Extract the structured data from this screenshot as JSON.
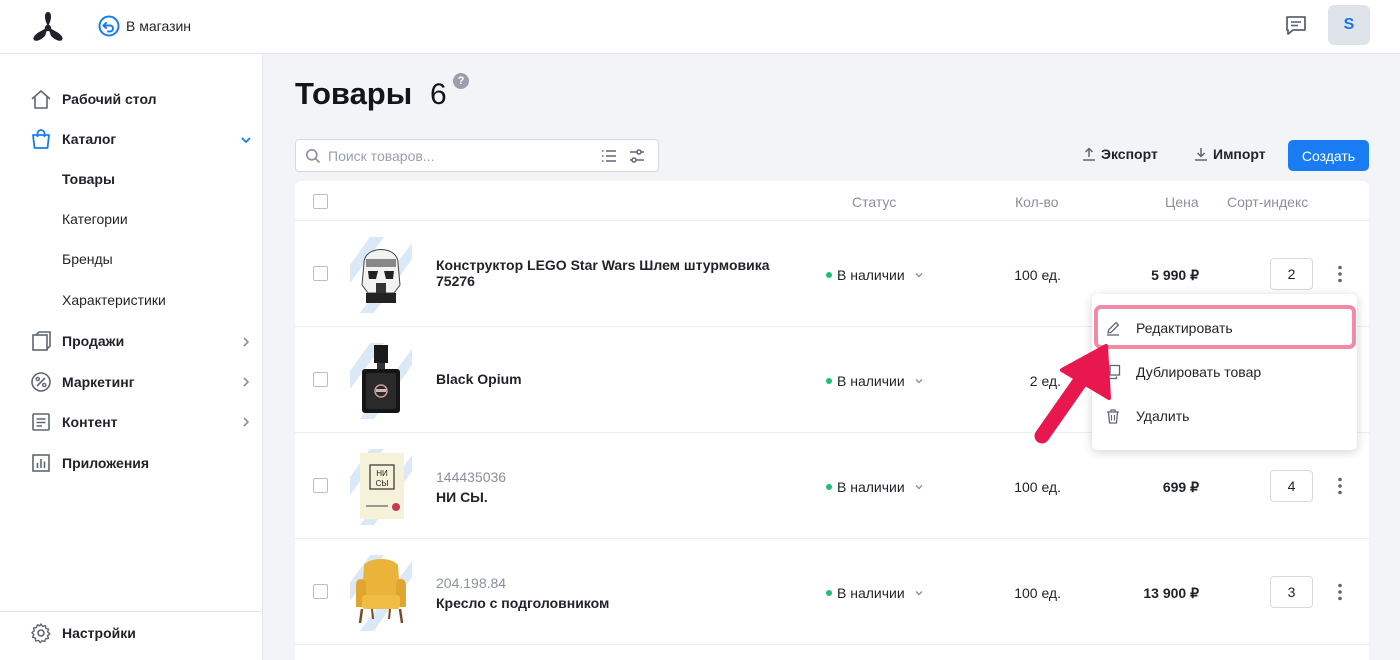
{
  "header": {
    "store_link": "В магазин",
    "avatar_initial": "S"
  },
  "sidebar": {
    "items": [
      {
        "label": "Рабочий стол",
        "icon": "home-icon"
      },
      {
        "label": "Каталог",
        "icon": "shopping-bag-icon",
        "expanded": true
      },
      {
        "label": "Продажи",
        "icon": "sales-icon"
      },
      {
        "label": "Маркетинг",
        "icon": "percent-icon"
      },
      {
        "label": "Контент",
        "icon": "content-icon"
      },
      {
        "label": "Приложения",
        "icon": "apps-chart-icon"
      }
    ],
    "catalog_subitems": [
      "Товары",
      "Категории",
      "Бренды",
      "Характеристики"
    ],
    "settings": "Настройки"
  },
  "page": {
    "title": "Товары",
    "count": "6",
    "help": "?"
  },
  "toolbar": {
    "search_placeholder": "Поиск товаров...",
    "export_label": "Экспорт",
    "import_label": "Импорт",
    "create_label": "Создать"
  },
  "table": {
    "headers": {
      "status": "Статус",
      "qty": "Кол-во",
      "price": "Цена",
      "sort": "Сорт-индекс"
    },
    "rows": [
      {
        "sku": "",
        "name": "Конструктор LEGO Star Wars Шлем штурмовика 75276",
        "status": "В наличии",
        "qty": "100 ед.",
        "price": "5 990 ₽",
        "sort": "2",
        "image": "lego-helmet"
      },
      {
        "sku": "",
        "name": "Black Opium",
        "status": "В наличии",
        "qty": "2 ед.",
        "price": "",
        "sort": "",
        "image": "perfume"
      },
      {
        "sku": "144435036",
        "name": "НИ СЫ.",
        "status": "В наличии",
        "qty": "100 ед.",
        "price": "699 ₽",
        "sort": "4",
        "image": "book"
      },
      {
        "sku": "204.198.84",
        "name": "Кресло с подголовником",
        "status": "В наличии",
        "qty": "100 ед.",
        "price": "13 900 ₽",
        "sort": "3",
        "image": "armchair"
      }
    ]
  },
  "context_menu": {
    "edit": "Редактировать",
    "duplicate": "Дублировать товар",
    "delete": "Удалить"
  },
  "colors": {
    "accent": "#1a7cf2",
    "status_ok": "#1fbf75",
    "highlight": "#f08aa7",
    "arrow": "#e8184f"
  }
}
